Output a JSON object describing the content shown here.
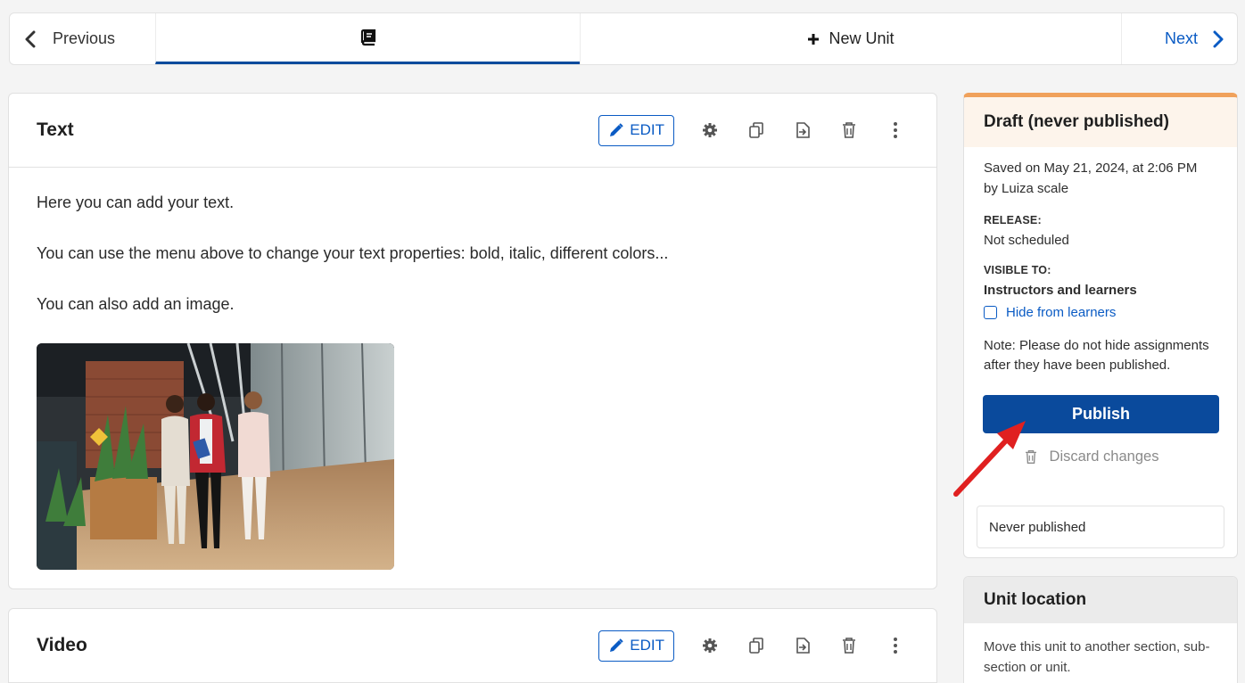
{
  "nav": {
    "previous_label": "Previous",
    "new_unit_label": "New Unit",
    "next_label": "Next",
    "active_tab_icon": "book-icon",
    "accent_color": "#0a4a9c"
  },
  "components": [
    {
      "title": "Text",
      "edit_label": "EDIT",
      "paragraphs": [
        "Here you can add your text.",
        "You can use the menu above to change your text properties: bold, italic, different colors...",
        "You can also add an image."
      ],
      "image_icon": "office-photo"
    },
    {
      "title": "Video",
      "edit_label": "EDIT"
    }
  ],
  "toolbar_icons": [
    "gear-icon",
    "duplicate-icon",
    "move-icon",
    "trash-icon",
    "more-vertical-icon"
  ],
  "status": {
    "title": "Draft (never published)",
    "saved_text": "Saved on May 21, 2024, at 2:06 PM",
    "saved_by": "by Luiza scale",
    "release_label": "RELEASE:",
    "release_value": "Not scheduled",
    "visible_label": "VISIBLE TO:",
    "visible_value": "Instructors and learners",
    "hide_label": "Hide from learners",
    "hide_checked": false,
    "note": "Note: Please do not hide assignments after they have been published.",
    "publish_label": "Publish",
    "discard_label": "Discard changes",
    "never_published": "Never published",
    "header_accent": "#f0a15b"
  },
  "location": {
    "title": "Unit location",
    "description": "Move this unit to another section, sub-section or unit."
  }
}
